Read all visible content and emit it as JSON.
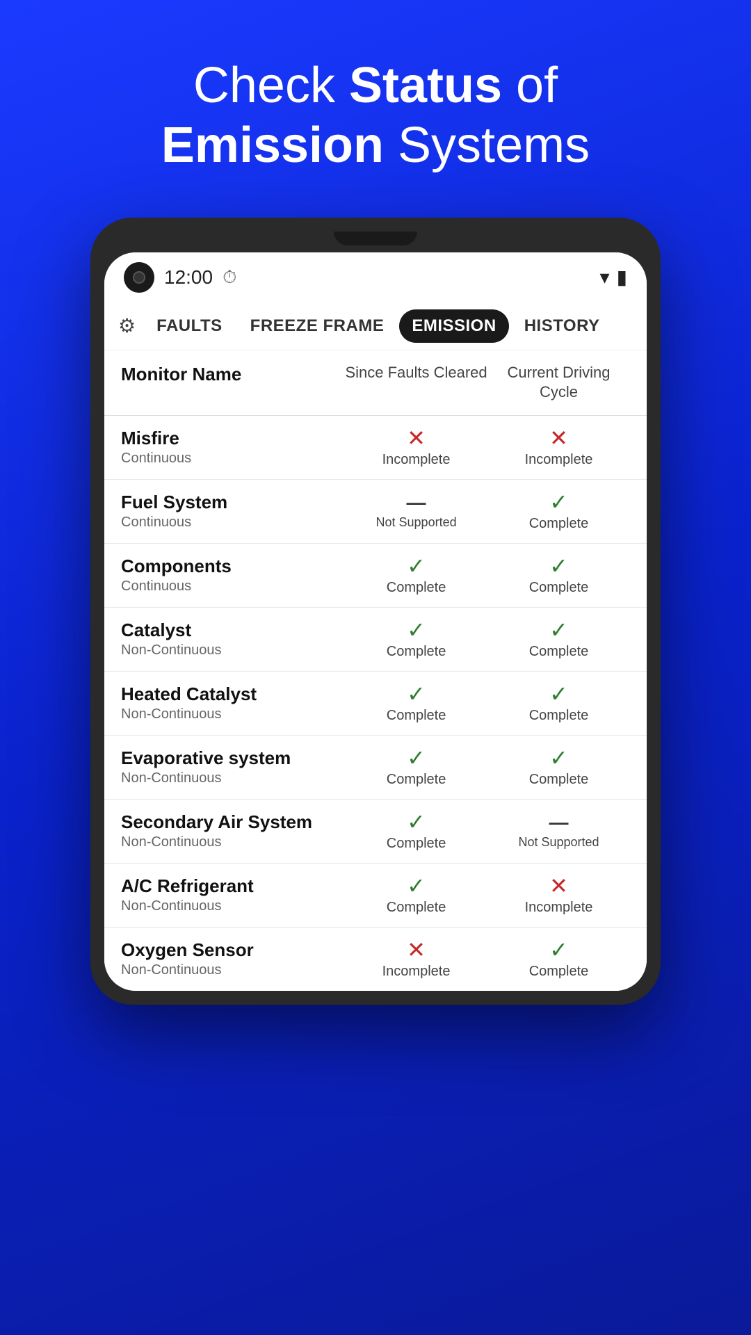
{
  "hero": {
    "line1": "Check ",
    "highlight1": "Status",
    "line2": " of",
    "line3_bold": "Emission",
    "line3_rest": " Systems"
  },
  "statusBar": {
    "time": "12:00",
    "wifiIcon": "wifi",
    "batteryIcon": "battery"
  },
  "tabs": [
    {
      "label": "Faults",
      "active": false
    },
    {
      "label": "Freeze Frame",
      "active": false
    },
    {
      "label": "Emission",
      "active": true
    },
    {
      "label": "History",
      "active": false
    }
  ],
  "tableHeaders": {
    "col1": "Monitor Name",
    "col2": "Since Faults Cleared",
    "col3": "Current Driving Cycle"
  },
  "rows": [
    {
      "name": "Misfire",
      "type": "Continuous",
      "col2_status": "incomplete",
      "col2_label": "Incomplete",
      "col3_status": "incomplete",
      "col3_label": "Incomplete"
    },
    {
      "name": "Fuel System",
      "type": "Continuous",
      "col2_status": "not-supported",
      "col2_label": "Not Supported",
      "col3_status": "complete",
      "col3_label": "Complete"
    },
    {
      "name": "Components",
      "type": "Continuous",
      "col2_status": "complete",
      "col2_label": "Complete",
      "col3_status": "complete",
      "col3_label": "Complete"
    },
    {
      "name": "Catalyst",
      "type": "Non-Continuous",
      "col2_status": "complete",
      "col2_label": "Complete",
      "col3_status": "complete",
      "col3_label": "Complete"
    },
    {
      "name": "Heated Catalyst",
      "type": "Non-Continuous",
      "col2_status": "complete",
      "col2_label": "Complete",
      "col3_status": "complete",
      "col3_label": "Complete"
    },
    {
      "name": "Evaporative system",
      "type": "Non-Continuous",
      "col2_status": "complete",
      "col2_label": "Complete",
      "col3_status": "complete",
      "col3_label": "Complete"
    },
    {
      "name": "Secondary Air System",
      "type": "Non-Continuous",
      "col2_status": "complete",
      "col2_label": "Complete",
      "col3_status": "not-supported",
      "col3_label": "Not Supported"
    },
    {
      "name": "A/C Refrigerant",
      "type": "Non-Continuous",
      "col2_status": "complete",
      "col2_label": "Complete",
      "col3_status": "incomplete",
      "col3_label": "Incomplete"
    },
    {
      "name": "Oxygen Sensor",
      "type": "Non-Continuous",
      "col2_status": "incomplete",
      "col2_label": "Incomplete",
      "col3_status": "complete",
      "col3_label": "Complete"
    }
  ]
}
